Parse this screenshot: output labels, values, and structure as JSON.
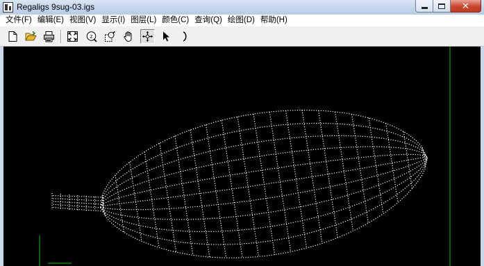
{
  "window": {
    "title": "Regaligs 9sug-03.igs",
    "close_glyph": "✕"
  },
  "menubar": {
    "items": [
      {
        "label": "文件(F)"
      },
      {
        "label": "编辑(E)"
      },
      {
        "label": "视图(V)"
      },
      {
        "label": "显示(I)"
      },
      {
        "label": "图层(L)"
      },
      {
        "label": "颜色(C)"
      },
      {
        "label": "查询(Q)"
      },
      {
        "label": "绘图(D)"
      },
      {
        "label": "帮助(H)"
      }
    ]
  },
  "toolbar": {
    "buttons": [
      {
        "icon": "new-file-icon"
      },
      {
        "icon": "open-folder-icon"
      },
      {
        "icon": "print-icon"
      },
      {
        "icon": "zoom-fit-icon"
      },
      {
        "icon": "zoom-icon"
      },
      {
        "icon": "zoom-window-icon"
      },
      {
        "icon": "pan-hand-icon"
      },
      {
        "icon": "rotate-move-icon",
        "pressed": true
      },
      {
        "icon": "select-arrow-icon"
      },
      {
        "icon": "arc-icon"
      }
    ]
  },
  "viewport": {
    "background": "#000000",
    "mesh_color": "#ffffff",
    "axis_color": "#00c800"
  }
}
